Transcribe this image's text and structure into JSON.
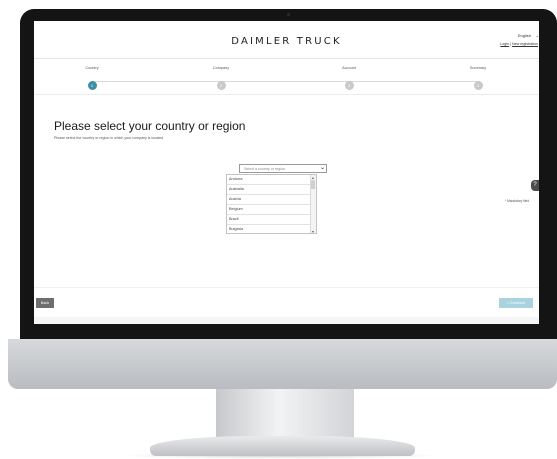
{
  "header": {
    "brand": "DAIMLER TRUCK",
    "language": "English",
    "language_chevron": "⌄",
    "login_label": "Login",
    "register_label": "New registration"
  },
  "stepper": {
    "steps": [
      {
        "label": "Country",
        "number": "1",
        "active": true
      },
      {
        "label": "Company",
        "number": "2",
        "active": false
      },
      {
        "label": "Account",
        "number": "3",
        "active": false
      },
      {
        "label": "Summary",
        "number": "4",
        "active": false
      }
    ]
  },
  "main": {
    "title": "Please select your country or region",
    "subtitle": "Please select the country or region in which your company is located",
    "select": {
      "placeholder": "Select a country or region",
      "chevron": "⌄"
    },
    "options": [
      "Andorra",
      "Australia",
      "Austria",
      "Belgium",
      "Brazil",
      "Bulgaria"
    ],
    "mandatory_note": "* Mandatory field",
    "help_icon_glyph": "?"
  },
  "footer": {
    "back_label": "Back",
    "continue_label": "> Continue"
  },
  "colors": {
    "accent": "#3e8fa6",
    "continue_disabled": "#a9d3df",
    "back_button": "#6e6e6e"
  },
  "icons": [
    "chevron-down-icon",
    "help-icon",
    "scroll-up-icon",
    "scroll-down-icon"
  ]
}
